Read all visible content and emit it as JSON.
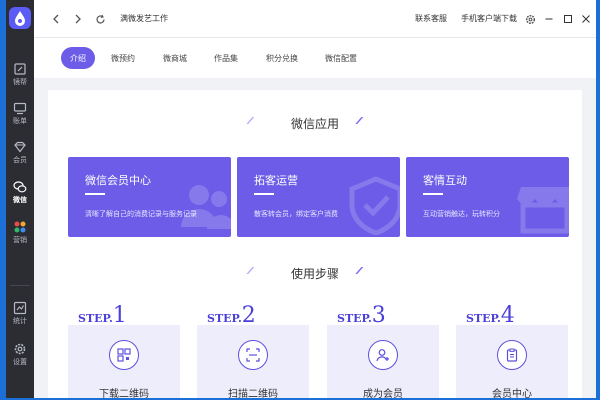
{
  "app": {
    "title": "满微发艺工作",
    "nav_items": [
      {
        "label": "镜帮",
        "icon": "edit-icon"
      },
      {
        "label": "账单",
        "icon": "monitor-icon"
      },
      {
        "label": "会员",
        "icon": "diamond-icon"
      },
      {
        "label": "微信",
        "icon": "wechat-icon",
        "active": true
      },
      {
        "label": "营销",
        "icon": "grid-icon"
      },
      {
        "label": "统计",
        "icon": "chart-icon"
      },
      {
        "label": "设置",
        "icon": "gear-icon"
      }
    ],
    "titlebar_links": {
      "support": "联系客服",
      "mobile_download": "手机客户端下载"
    }
  },
  "tabs": [
    {
      "label": "介绍",
      "active": true
    },
    {
      "label": "微预约"
    },
    {
      "label": "微商城"
    },
    {
      "label": "作品集"
    },
    {
      "label": "积分兑换"
    },
    {
      "label": "微信配置"
    }
  ],
  "section_wechat": {
    "title": "微信应用",
    "cards": [
      {
        "title": "微信会员中心",
        "desc": "清晰了解自己的消费记录与服务记录"
      },
      {
        "title": "拓客运营",
        "desc": "散客转会员，绑定客户消费"
      },
      {
        "title": "客情互动",
        "desc": "互动营销触达，玩转积分"
      }
    ]
  },
  "section_steps": {
    "title": "使用步骤",
    "step_word": "STEP.",
    "steps": [
      {
        "num": "1",
        "label": "下载二维码",
        "icon": "qrcode-icon"
      },
      {
        "num": "2",
        "label": "扫描二维码",
        "icon": "scan-icon"
      },
      {
        "num": "3",
        "label": "成为会员",
        "icon": "add-user-icon"
      },
      {
        "num": "4",
        "label": "会员中心",
        "icon": "clipboard-icon"
      }
    ]
  },
  "colors": {
    "accent": "#6c5ce7",
    "nav_bg": "#2b2d33",
    "step_text": "#4a3fd8"
  }
}
